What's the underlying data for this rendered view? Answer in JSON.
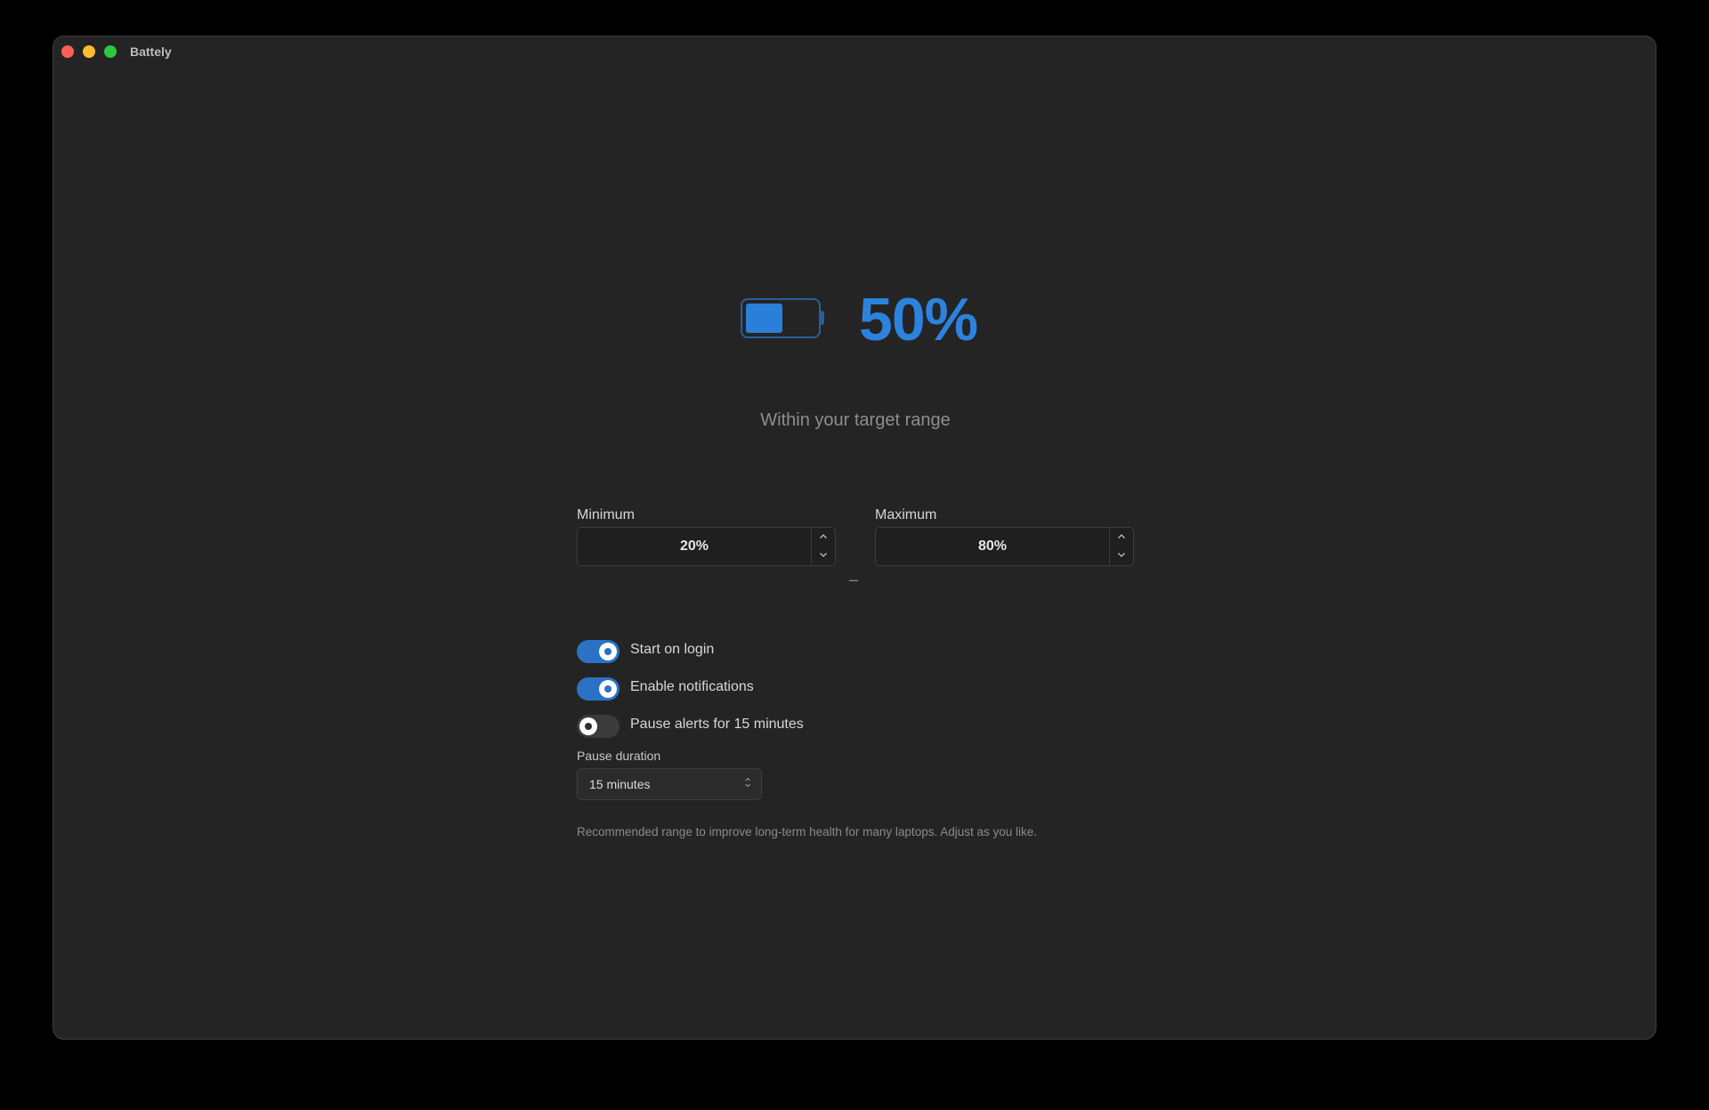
{
  "window": {
    "title": "Battely",
    "traffic_lights": {
      "close_color": "#ff5f57",
      "minimize_color": "#febc2e",
      "zoom_color": "#28c840"
    }
  },
  "battery": {
    "level": 0.5,
    "percent_label": "50%",
    "status": "Within your target range",
    "accent_color": "#2b83dd"
  },
  "range": {
    "minimum": {
      "label": "Minimum",
      "value": "20%"
    },
    "separator": "–",
    "maximum": {
      "label": "Maximum",
      "value": "80%"
    },
    "increment_icon": "chevron-up-icon",
    "decrement_icon": "chevron-down-icon"
  },
  "toggles": [
    {
      "label": "Start on login",
      "on": true
    },
    {
      "label": "Enable notifications",
      "on": true
    },
    {
      "label": "Pause alerts for 15 minutes",
      "on": false
    }
  ],
  "pause": {
    "label": "Pause duration",
    "selected": "15 minutes",
    "icon": "up-down-chevrons-icon"
  },
  "helper_text": "Recommended range to improve long-term health for many laptops. Adjust as you like."
}
